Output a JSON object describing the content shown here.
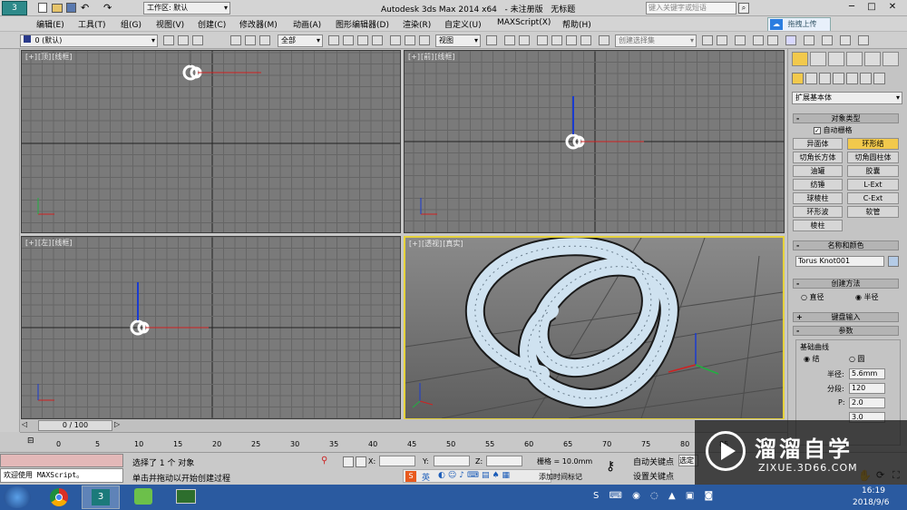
{
  "title": {
    "quick_workspace": "工作区: 默认",
    "app": "Autodesk 3ds Max  2014 x64",
    "doc": "- 未注册版",
    "file": "无标题",
    "search_placeholder": "键入关键字或短语"
  },
  "menu": [
    "编辑(E)",
    "工具(T)",
    "组(G)",
    "视图(V)",
    "创建(C)",
    "修改器(M)",
    "动画(A)",
    "图形编辑器(D)",
    "渲染(R)",
    "自定义(U)",
    "MAXScript(X)",
    "帮助(H)"
  ],
  "upload_btn": "拖拽上传",
  "toolbar": {
    "layer": "0 (默认)",
    "filter": "全部",
    "coord": "视图",
    "selset": "创建选择集"
  },
  "viewports": {
    "top": [
      "[+]",
      "[顶]",
      "[线框]"
    ],
    "front": [
      "[+]",
      "[前]",
      "[线框]"
    ],
    "left": [
      "[+]",
      "[左]",
      "[线框]"
    ],
    "persp": [
      "[+]",
      "[透视]",
      "[真实]"
    ]
  },
  "panel": {
    "category": "扩展基本体",
    "obj_type_title": "对象类型",
    "autogrid": "自动栅格",
    "buttons": [
      "异面体",
      "环形结",
      "切角长方体",
      "切角圆柱体",
      "油罐",
      "胶囊",
      "纺锤",
      "L-Ext",
      "球棱柱",
      "C-Ext",
      "环形波",
      "软管",
      "棱柱"
    ],
    "name_color_title": "名称和颜色",
    "object_name": "Torus Knot001",
    "creation_method_title": "创建方法",
    "radio_diameter": "直径",
    "radio_radius": "半径",
    "keyboard_title": "键盘输入",
    "params_title": "参数",
    "base_curve": "基础曲线",
    "radio_knot": "结",
    "radio_circle": "圆",
    "radius_label": "半径:",
    "radius_value": "5.6mm",
    "segments_label": "分段:",
    "segments_value": "120",
    "p_label": "P:",
    "p_value": "2.0",
    "q_value": "3.0"
  },
  "timeline": {
    "frame": "0 / 100",
    "ticks": [
      "0",
      "5",
      "10",
      "15",
      "20",
      "25",
      "30",
      "35",
      "40",
      "45",
      "50",
      "55",
      "60",
      "65",
      "70",
      "75",
      "80",
      "85",
      "90"
    ]
  },
  "status": {
    "selection": "选择了 1 个 对象",
    "prompt": "单击并拖动以开始创建过程",
    "maxscript": "欢迎使用 MAXScript。",
    "x_label": "X:",
    "y_label": "Y:",
    "z_label": "Z:",
    "grid": "栅格 = 10.0mm",
    "autokey": "自动关键点",
    "setkey": "设置关键点",
    "sel_mode": "选定",
    "add_time_tag": "添加时间标记",
    "ime": "英"
  },
  "taskbar": {
    "time": "16:19",
    "date": "2018/9/6"
  },
  "watermark": {
    "brand": "溜溜自学",
    "url": "ZIXUE.3D66.COM"
  }
}
